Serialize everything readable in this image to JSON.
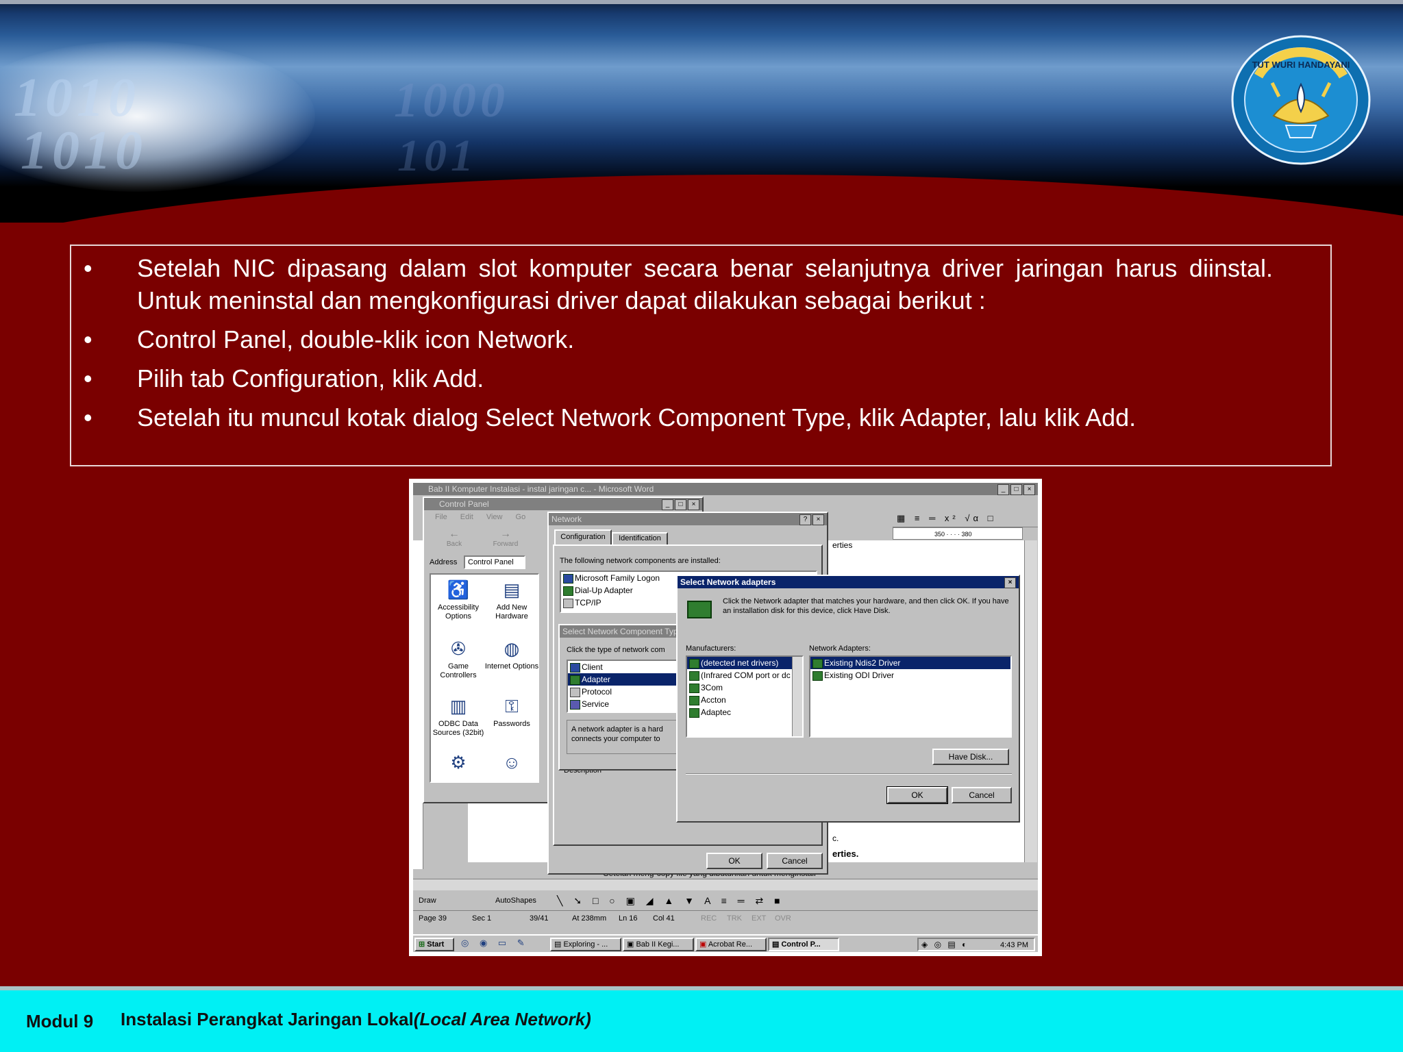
{
  "slide": {
    "bullets": [
      "Setelah  NIC  dipasang  dalam  slot  komputer  secara benar  selanjutnya driver jaringan harus diinstal. Untuk meninstal dan mengkonfigurasi driver dapat dilakukan sebagai berikut :",
      "Control Panel, double-klik icon Network.",
      "Pilih tab Configuration, klik Add.",
      "Setelah itu muncul kotak dialog Select Network Component Type, klik Adapter, lalu klik Add."
    ]
  },
  "footer": {
    "module": "Modul 9",
    "title": "Instalasi Perangkat Jaringan Lokal",
    "title_italic": "(Local Area Network)"
  },
  "banner": {
    "digits_1": "1010",
    "digits_2": "1010",
    "digits_3": "1000",
    "digits_4": "101",
    "logo_text": "TUT WURI HANDAYANI"
  },
  "screenshot": {
    "word_title": "Bab II Komputer Instalasi - instal jaringan c... - Microsoft Word",
    "control_panel": {
      "title": "Control Panel",
      "menu": [
        "File",
        "Edit",
        "View",
        "Go"
      ],
      "back": "Back",
      "forward": "Forward",
      "address_label": "Address",
      "address_value": "Control Panel",
      "icons": [
        "Accessibility Options",
        "Add New Hardware",
        "Game Controllers",
        "Internet Options",
        "ODBC Data Sources (32bit)",
        "Passwords"
      ]
    },
    "network": {
      "title": "Network",
      "tabs": [
        "Configuration",
        "Identification"
      ],
      "installed_label": "The following network components are installed:",
      "components": [
        "Microsoft Family Logon",
        "Dial-Up Adapter",
        "TCP/IP"
      ],
      "ok": "OK",
      "cancel": "Cancel",
      "description": "Description"
    },
    "component_type": {
      "title": "Select Network Component Type",
      "prompt": "Click the type of network com",
      "items": [
        "Client",
        "Adapter",
        "Protocol",
        "Service"
      ],
      "desc": "A network adapter is a hard connects your computer to"
    },
    "adapters": {
      "title": "Select Network adapters",
      "instruction": "Click the Network adapter that matches your hardware, and then click OK. If you have an installation disk for this device, click Have Disk.",
      "manufacturers_label": "Manufacturers:",
      "manufacturers": [
        "(detected net drivers)",
        "(Infrared COM port or dc",
        "3Com",
        "Accton",
        "Adaptec"
      ],
      "adapters_label": "Network Adapters:",
      "adapters": [
        "Existing Ndis2 Driver",
        "Existing ODI Driver"
      ],
      "have_disk": "Have Disk...",
      "ok": "OK",
      "cancel": "Cancel"
    },
    "word_doc": {
      "right_fragment_1": "erties",
      "right_fragment_2": "c.",
      "right_fragment_3": "erties.",
      "doc_line": "Setelah meng-copy file yang dibutuhkan untuk menginstall",
      "ruler": "350 · · · · 380"
    },
    "drawing_bar": {
      "draw": "Draw",
      "autoshapes": "AutoShapes"
    },
    "status_bar": [
      "Page  39",
      "Sec  1",
      "39/41",
      "At  238mm",
      "Ln  16",
      "Col  41",
      "REC",
      "TRK",
      "EXT",
      "OVR"
    ],
    "taskbar": {
      "start": "Start",
      "tasks": [
        "Exploring - ...",
        "Bab II Kegi...",
        "Acrobat Re...",
        "Control P..."
      ],
      "clock": "4:43 PM"
    }
  }
}
